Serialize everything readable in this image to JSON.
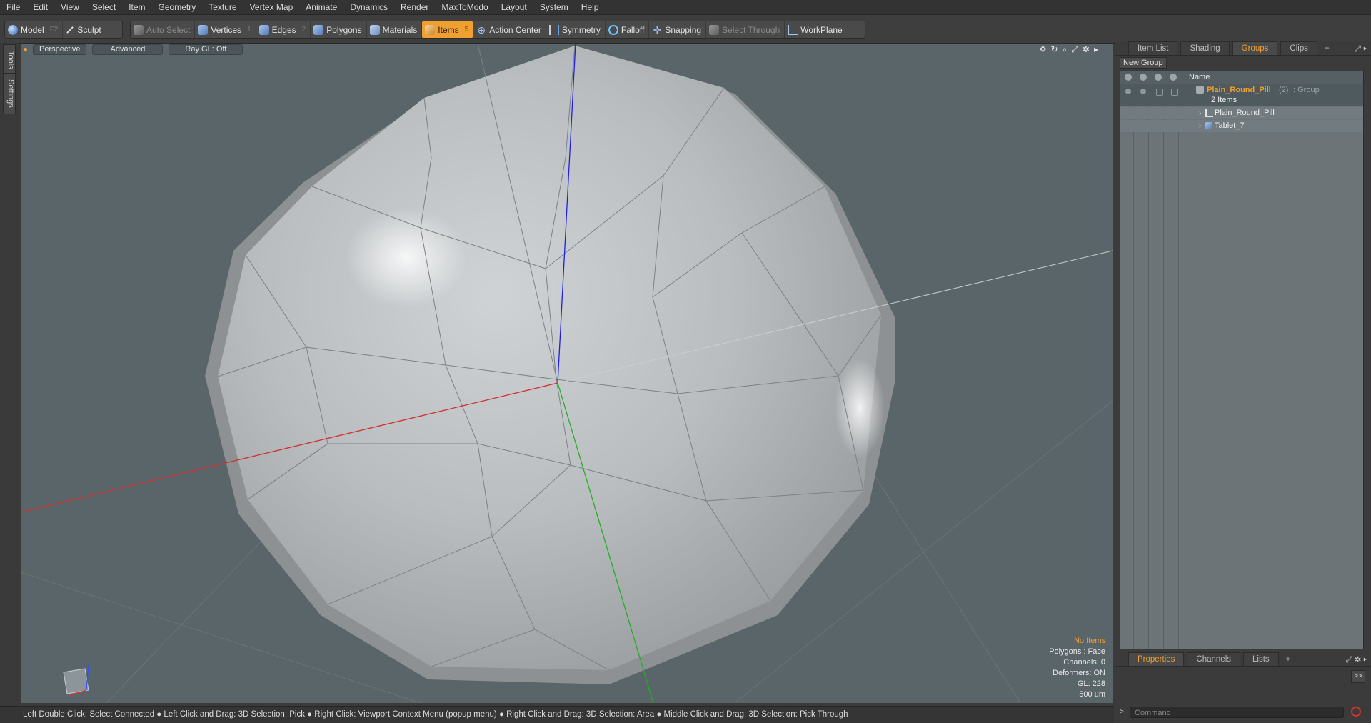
{
  "menu": [
    "File",
    "Edit",
    "View",
    "Select",
    "Item",
    "Geometry",
    "Texture",
    "Vertex Map",
    "Animate",
    "Dynamics",
    "Render",
    "MaxToModo",
    "Layout",
    "System",
    "Help"
  ],
  "toolbar": {
    "model": "Model",
    "model_key": "F2",
    "sculpt": "Sculpt",
    "auto_select": "Auto Select",
    "vertices": "Vertices",
    "vertices_key": "1",
    "edges": "Edges",
    "edges_key": "2",
    "polygons": "Polygons",
    "materials": "Materials",
    "items": "Items",
    "items_key": "5",
    "action_center": "Action Center",
    "symmetry": "Symmetry",
    "falloff": "Falloff",
    "snapping": "Snapping",
    "select_through": "Select Through",
    "workplane": "WorkPlane"
  },
  "left_tabs": {
    "tools": "Tools",
    "settings": "Settings"
  },
  "viewport": {
    "perspective": "Perspective",
    "advanced": "Advanced",
    "raygl": "Ray GL: Off",
    "info": {
      "no_items": "No Items",
      "polygons": "Polygons : Face",
      "channels": "Channels: 0",
      "deformers": "Deformers: ON",
      "gl": "GL: 228",
      "scale": "500 um"
    },
    "axis_colors": {
      "x": "#d03030",
      "y": "#20b020",
      "z": "#2020e0"
    }
  },
  "status": "Left Double Click: Select Connected ● Left Click and Drag: 3D Selection: Pick ● Right Click: Viewport Context Menu (popup menu) ● Right Click and Drag: 3D Selection: Area ● Middle Click and Drag: 3D Selection: Pick Through",
  "right_panel": {
    "tabs": [
      "Item List",
      "Shading",
      "Groups",
      "Clips",
      "+"
    ],
    "new_group": "New Group",
    "name_col": "Name",
    "group": {
      "name": "Plain_Round_Pill",
      "count": "(2)",
      "type": ": Group",
      "items_count": "2 Items"
    },
    "children": [
      "Plain_Round_Pill",
      "Tablet_7"
    ],
    "bottom_tabs": [
      "Properties",
      "Channels",
      "Lists",
      "+"
    ],
    "command_placeholder": "Command"
  },
  "colors": {
    "accent": "#f0a030",
    "viewport_bg": "#5a6569"
  }
}
